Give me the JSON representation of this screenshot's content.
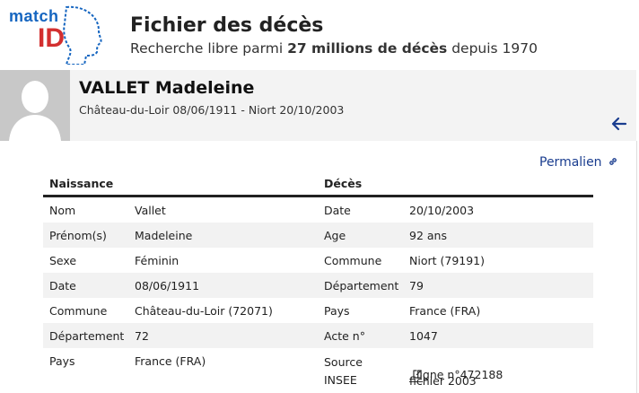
{
  "logo": {
    "match": "match",
    "id": "ID"
  },
  "site": {
    "title": "Fichier des décès",
    "subtitle_pre": "Recherche libre parmi ",
    "subtitle_bold": "27 millions de décès",
    "subtitle_post": " depuis 1970"
  },
  "person": {
    "name": "VALLET Madeleine",
    "summary": "Château-du-Loir 08/06/1911 - Niort 20/10/2003"
  },
  "icons": {
    "back": "arrow-left-icon",
    "permalink": "link-icon",
    "external": "external-link-icon"
  },
  "permalink_label": "Permalien",
  "table": {
    "headers": {
      "birth": "Naissance",
      "death": "Décès"
    },
    "rows": [
      {
        "l1": "Nom",
        "v1": "Vallet",
        "l2": "Date",
        "v2": "20/10/2003"
      },
      {
        "l1": "Prénom(s)",
        "v1": "Madeleine",
        "l2": "Age",
        "v2": "92 ans"
      },
      {
        "l1": "Sexe",
        "v1": "Féminin",
        "l2": "Commune",
        "v2": "Niort (79191)"
      },
      {
        "l1": "Date",
        "v1": "08/06/1911",
        "l2": "Département",
        "v2": "79"
      },
      {
        "l1": "Commune",
        "v1": "Château-du-Loir (72071)",
        "l2": "Pays",
        "v2": "France (FRA)"
      },
      {
        "l1": "Département",
        "v1": "72",
        "l2": "Acte n°",
        "v2": "1047"
      },
      {
        "l1": "Pays",
        "v1": "France (FRA)",
        "l2": "Source INSEE",
        "v2_link": "fichier 2003",
        "v2_rest": ", ligne n°472188"
      }
    ]
  },
  "colors": {
    "brand_blue": "#1565c0",
    "brand_red": "#d32f2f",
    "link": "#1a3d8f",
    "banner": "#f3f3f3"
  }
}
